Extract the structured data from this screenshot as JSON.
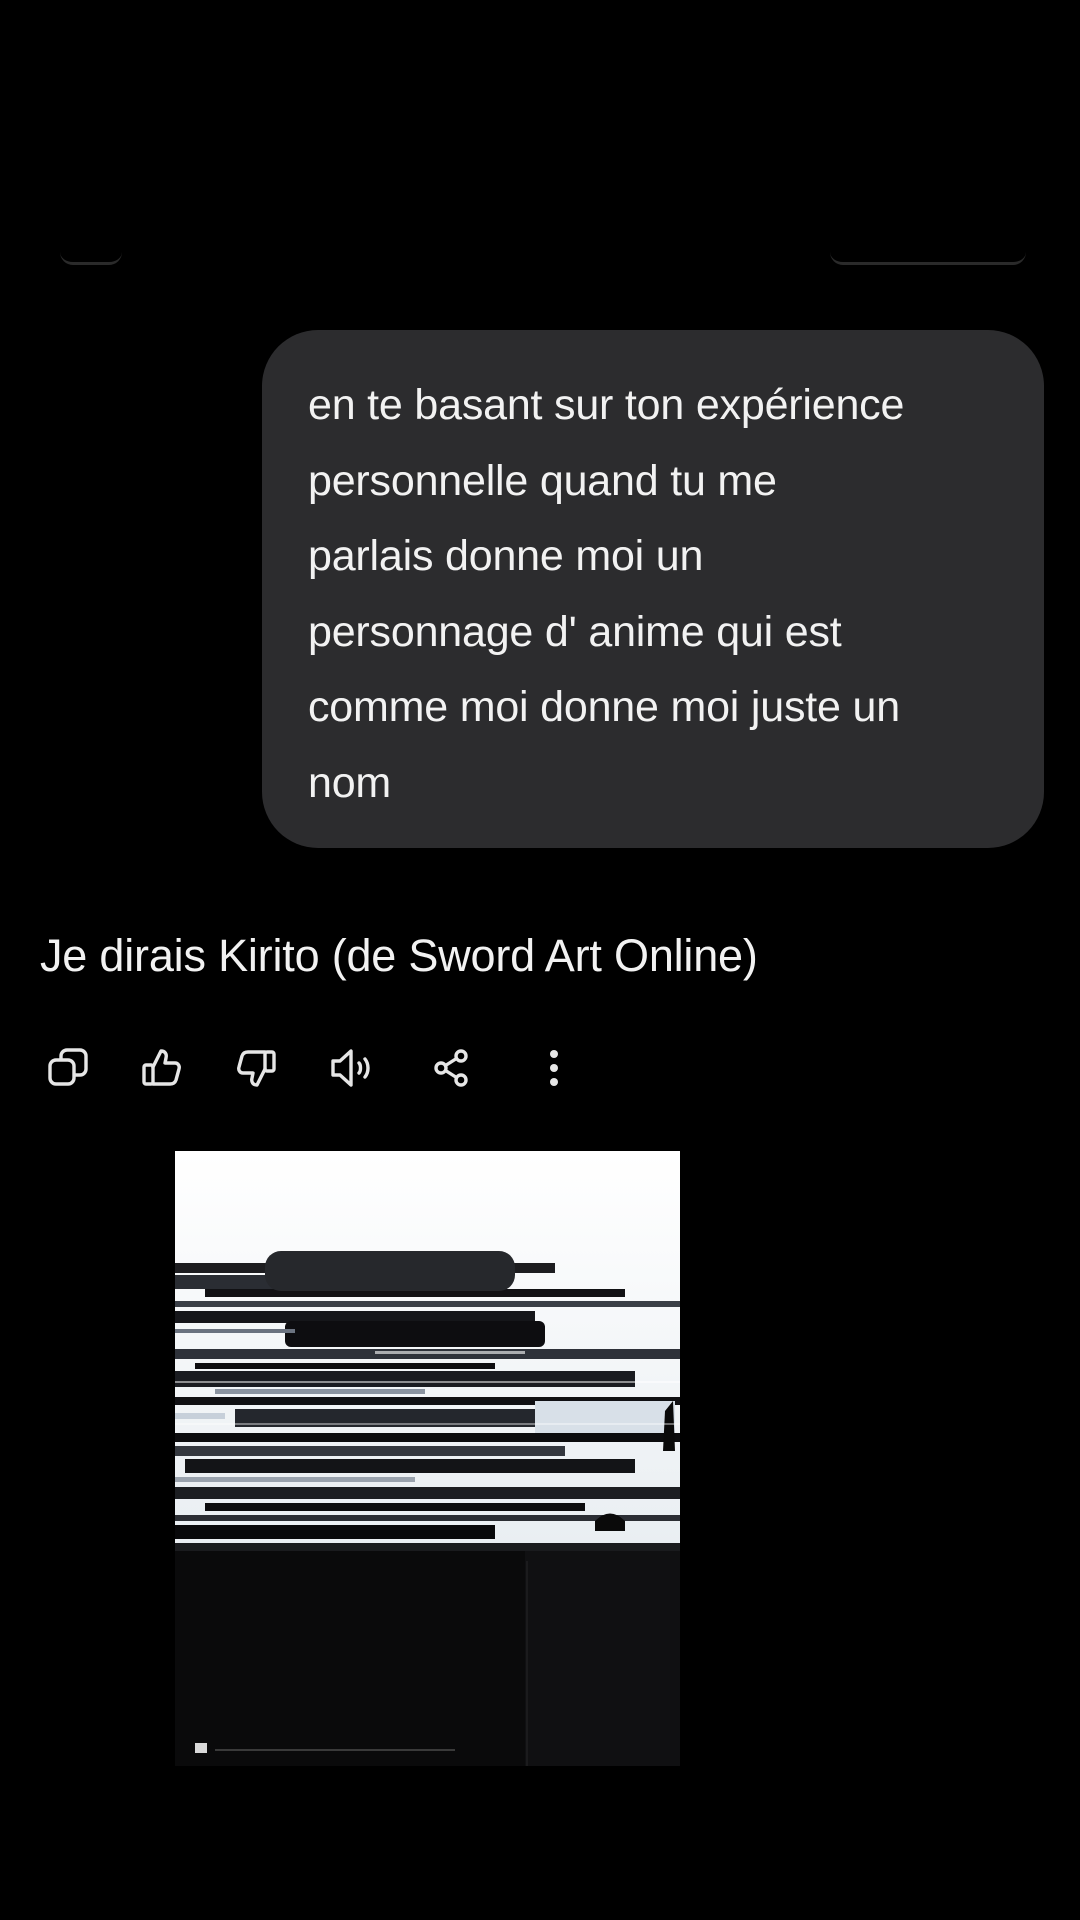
{
  "conversation": {
    "user_message": "en te basant sur ton expérience personnelle quand tu me parlais donne moi un personnage d' anime qui est comme moi donne moi juste un nom",
    "user_message_lines": [
      "en te basant sur ton expérience",
      "personnelle quand tu me",
      "parlais donne moi un",
      "personnage d' anime qui est",
      "comme moi donne moi juste un",
      "nom"
    ],
    "assistant_reply": "Je dirais Kirito (de Sword Art Online)"
  },
  "actions": [
    {
      "icon": "copy-icon"
    },
    {
      "icon": "thumbs-up-icon"
    },
    {
      "icon": "thumbs-down-icon"
    },
    {
      "icon": "speaker-icon"
    },
    {
      "icon": "share-icon"
    },
    {
      "icon": "more-vertical-icon"
    }
  ],
  "media": {
    "content": "glitched black-and-white anime image"
  },
  "colors": {
    "background": "#000000",
    "bubble": "#2c2c2e",
    "text": "#f2f2f2",
    "icon": "#e6e6e6"
  }
}
